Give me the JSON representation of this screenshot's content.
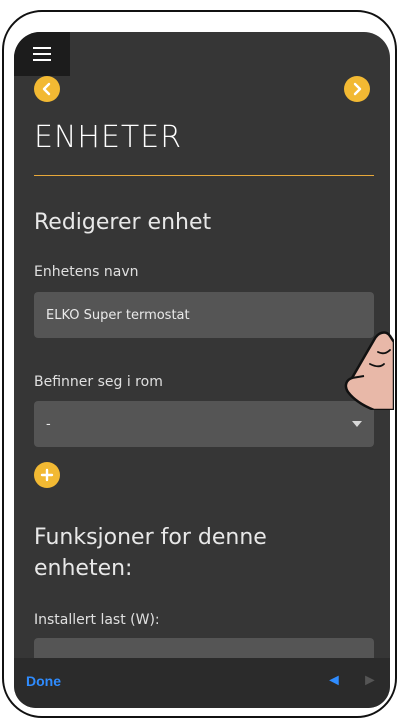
{
  "header": {
    "title": "ENHETER"
  },
  "form": {
    "subheading": "Redigerer enhet",
    "name_label": "Enhetens navn",
    "name_value": "ELKO Super termostat",
    "room_label": "Befinner seg i rom",
    "room_value": "-",
    "functions_heading": "Funksjoner for denne enheten:",
    "load_label": "Installert last (W):"
  },
  "keyboard_bar": {
    "done_label": "Done",
    "prev_arrow": "◄",
    "next_arrow": "►"
  },
  "colors": {
    "accent": "#f2b933",
    "background": "#363636",
    "field": "#555555",
    "ios_blue": "#2f8cff"
  },
  "icons": {
    "menu": "hamburger-menu-icon",
    "prev": "chevron-left-icon",
    "next": "chevron-right-icon",
    "add": "plus-icon",
    "caret": "caret-down-icon",
    "hand": "pointing-hand-icon"
  }
}
